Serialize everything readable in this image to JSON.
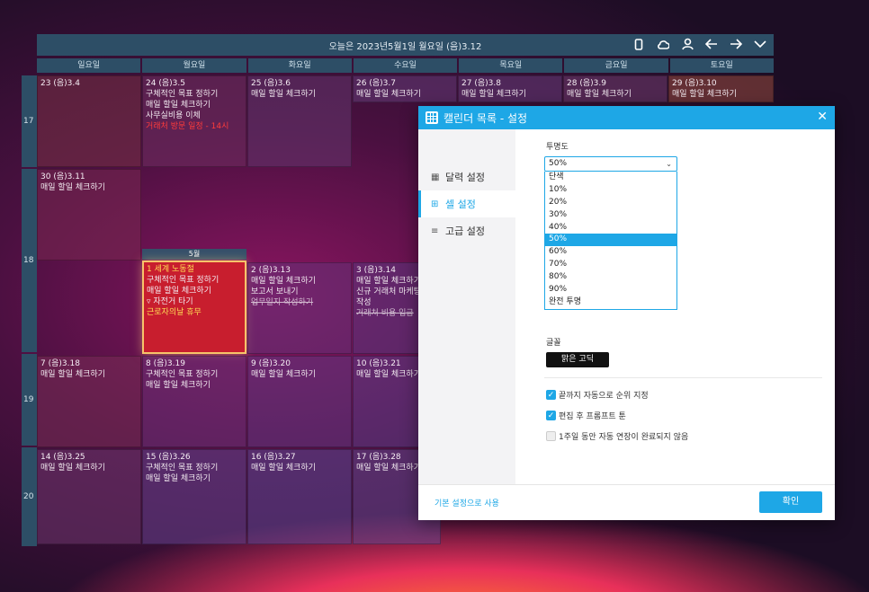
{
  "calendar": {
    "title": "오늘은 2023년5월1일 월요일 (음)3.12",
    "weekdays": [
      "일요일",
      "월요일",
      "화요일",
      "수요일",
      "목요일",
      "금요일",
      "토요일"
    ],
    "weeks": [
      "17",
      "18",
      "19",
      "20"
    ],
    "month_label": "5월",
    "cells": {
      "w17": [
        {
          "date": "23 (음)3.4",
          "lines": []
        },
        {
          "date": "24 (음)3.5",
          "lines": [
            "구체적인 목표 정하기",
            "매일 할일 체크하기",
            "사무실비용 이체"
          ],
          "red": "거래처 방문 일정 - 14시"
        },
        {
          "date": "25 (음)3.6",
          "lines": [
            "매일 할일 체크하기"
          ]
        },
        {
          "date": "26 (음)3.7",
          "lines": [
            "매일 할일 체크하기"
          ]
        },
        {
          "date": "27 (음)3.8",
          "lines": [
            "매일 할일 체크하기"
          ]
        },
        {
          "date": "28 (음)3.9",
          "lines": [
            "매일 할일 체크하기"
          ]
        },
        {
          "date": "29 (음)3.10",
          "lines": [
            "매일 할일 체크하기"
          ]
        }
      ],
      "w18a": {
        "date": "30 (음)3.11",
        "lines": [
          "매일 할일 체크하기"
        ]
      },
      "w18": [
        {
          "date": "1 세계 노동절",
          "lines": [
            "구체적인 목표 정하기",
            "매일 할일 체크하기",
            "자전거 타기"
          ],
          "holiday": "근로자의날 휴무"
        },
        {
          "date": "2 (음)3.13",
          "lines": [
            "매일 할일 체크하기",
            "보고서 보내기"
          ],
          "strike": "업무일지 작성하기"
        },
        {
          "date": "3 (음)3.14",
          "lines": [
            "매일 할일 체크하기",
            "신규 거래처 마케팅",
            "작성"
          ],
          "strike": "거래처 비용 입금"
        }
      ],
      "w19": [
        {
          "date": "7 (음)3.18",
          "lines": [
            "매일 할일 체크하기"
          ]
        },
        {
          "date": "8 (음)3.19",
          "lines": [
            "구체적인 목표 정하기",
            "매일 할일 체크하기"
          ]
        },
        {
          "date": "9 (음)3.20",
          "lines": [
            "매일 할일 체크하기"
          ]
        },
        {
          "date": "10 (음)3.21",
          "lines": [
            "매일 할일 체크하기"
          ]
        }
      ],
      "w20": [
        {
          "date": "14 (음)3.25",
          "lines": [
            "매일 할일 체크하기"
          ]
        },
        {
          "date": "15 (음)3.26",
          "lines": [
            "구체적인 목표 정하기",
            "매일 할일 체크하기"
          ]
        },
        {
          "date": "16 (음)3.27",
          "lines": [
            "매일 할일 체크하기"
          ]
        },
        {
          "date": "17 (음)3.28",
          "lines": [
            "매일 할일 체크하기"
          ]
        }
      ]
    }
  },
  "modal": {
    "title": "캘린더 목록 - 설정",
    "sidebar": [
      "달력 설정",
      "셀 설정",
      "고급 설정"
    ],
    "opacity_label": "투명도",
    "opacity_value": "50%",
    "opacity_options": [
      "단색",
      "10%",
      "20%",
      "30%",
      "40%",
      "50%",
      "60%",
      "70%",
      "80%",
      "90%",
      "완전 투명"
    ],
    "font_label": "글꼴",
    "font_value": "맑은 고딕",
    "checkboxes": [
      {
        "label": "끝까지 자동으로 순위 지정",
        "checked": true
      },
      {
        "label": "편집 후 프롬프트 툰",
        "checked": true
      },
      {
        "label": "1주일 동안 자동 연장이 완료되지 않음",
        "checked": false
      }
    ],
    "reset_label": "기본 설정으로 사용",
    "ok_label": "확인"
  }
}
